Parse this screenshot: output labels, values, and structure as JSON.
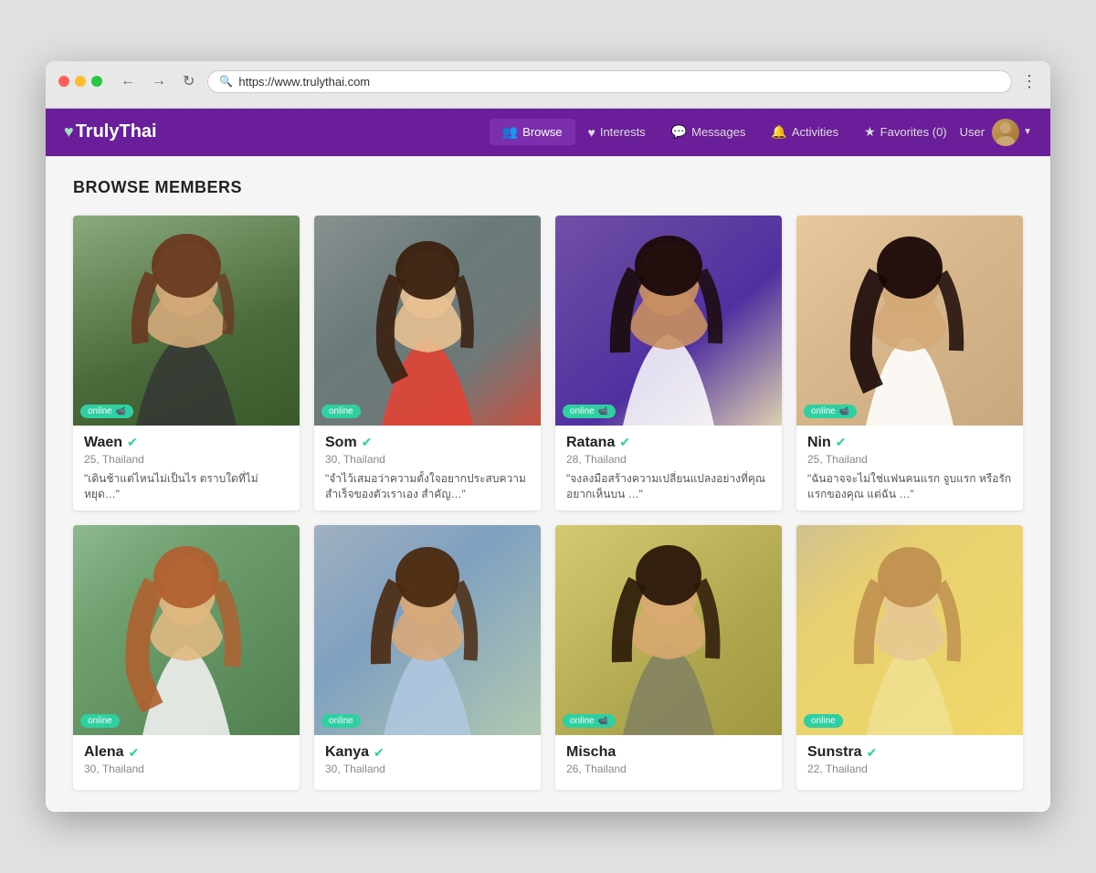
{
  "browser": {
    "url": "https://www.trulythai.com",
    "back_label": "←",
    "forward_label": "→",
    "refresh_label": "↻",
    "menu_label": "⋮"
  },
  "site": {
    "logo": "TrulyThai",
    "logo_icon": "♥",
    "nav": [
      {
        "id": "browse",
        "label": "Browse",
        "icon": "👥",
        "active": true
      },
      {
        "id": "interests",
        "label": "Interests",
        "icon": "♥"
      },
      {
        "id": "messages",
        "label": "Messages",
        "icon": "💬"
      },
      {
        "id": "activities",
        "label": "Activities",
        "icon": "🔔"
      },
      {
        "id": "favorites",
        "label": "Favorites (0)",
        "icon": "★"
      },
      {
        "id": "user",
        "label": "User",
        "icon": ""
      }
    ]
  },
  "page": {
    "title": "BROWSE MEMBERS"
  },
  "members": [
    {
      "id": "waen",
      "name": "Waen",
      "age": 25,
      "country": "Thailand",
      "online": true,
      "has_video": true,
      "verified": true,
      "quote": "\"เดินช้าแต่ไหนไม่เป็นไร ตราบใดที่ไม่หยุด…\"",
      "photo_class": "photo-waen"
    },
    {
      "id": "som",
      "name": "Som",
      "age": 30,
      "country": "Thailand",
      "online": true,
      "has_video": false,
      "verified": true,
      "quote": "\"จำไว้เสมอว่าความตั้งใจอยากประสบความสำเร็จของตัวเราเอง สำคัญ…\"",
      "photo_class": "photo-som"
    },
    {
      "id": "ratana",
      "name": "Ratana",
      "age": 28,
      "country": "Thailand",
      "online": true,
      "has_video": true,
      "verified": true,
      "quote": "\"จงลงมือสร้างความเปลี่ยนแปลงอย่างที่คุณอยากเห็นบน …\"",
      "photo_class": "photo-ratana"
    },
    {
      "id": "nin",
      "name": "Nin",
      "age": 25,
      "country": "Thailand",
      "online": true,
      "has_video": true,
      "verified": true,
      "quote": "\"ฉันอาจจะไม่ใช่แฟนคนแรก จูบแรก หรือรักแรกของคุณ แต่ฉัน …\"",
      "photo_class": "photo-nin"
    },
    {
      "id": "alena",
      "name": "Alena",
      "age": 30,
      "country": "Thailand",
      "online": true,
      "has_video": false,
      "verified": true,
      "quote": "",
      "photo_class": "photo-alena"
    },
    {
      "id": "kanya",
      "name": "Kanya",
      "age": 30,
      "country": "Thailand",
      "online": true,
      "has_video": false,
      "verified": true,
      "quote": "",
      "photo_class": "photo-kanya"
    },
    {
      "id": "mischa",
      "name": "Mischa",
      "age": 26,
      "country": "Thailand",
      "online": true,
      "has_video": true,
      "verified": false,
      "quote": "",
      "photo_class": "photo-mischa"
    },
    {
      "id": "sunstra",
      "name": "Sunstra",
      "age": 22,
      "country": "Thailand",
      "online": true,
      "has_video": false,
      "verified": true,
      "quote": "",
      "photo_class": "photo-sunstra"
    }
  ],
  "labels": {
    "online": "online",
    "verified_symbol": "✔"
  }
}
